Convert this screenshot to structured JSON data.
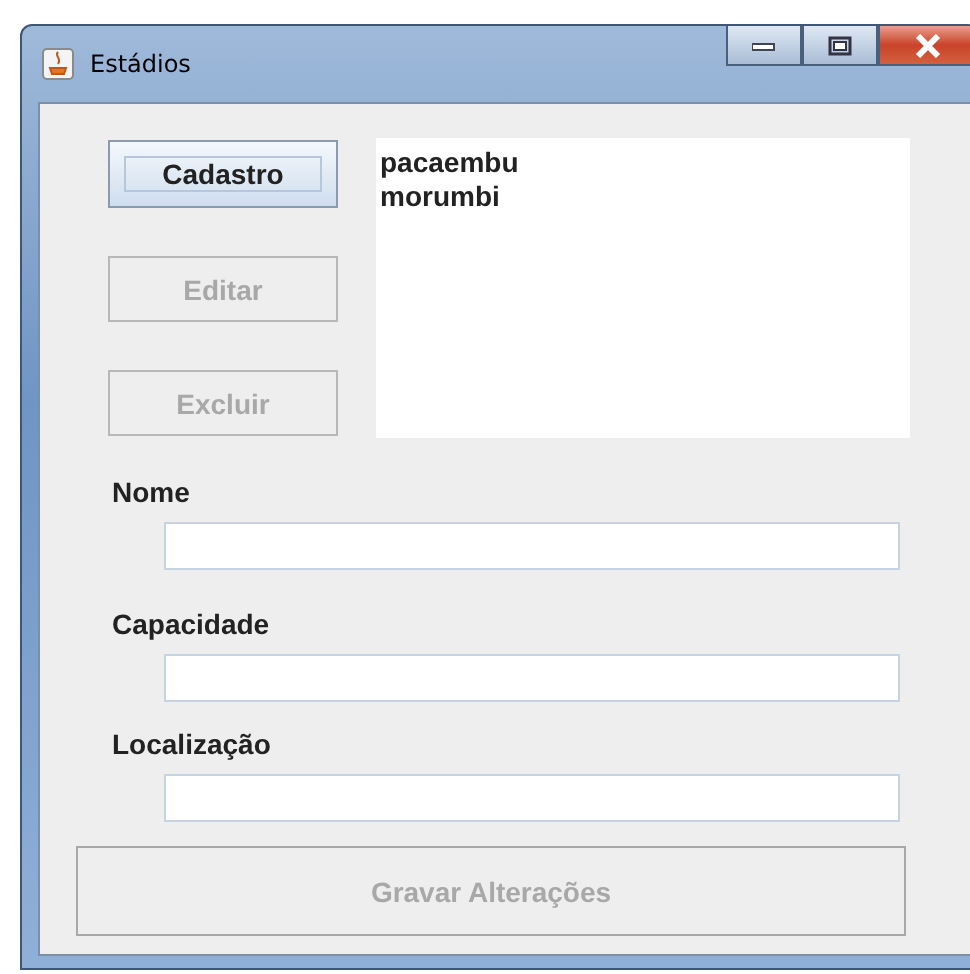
{
  "window": {
    "title": "Estádios"
  },
  "buttons": [
    {
      "label": "Cadastro",
      "disabled": false,
      "focused": true
    },
    {
      "label": "Editar",
      "disabled": true,
      "focused": false
    },
    {
      "label": "Excluir",
      "disabled": true,
      "focused": false
    }
  ],
  "list": {
    "items": [
      "pacaembu",
      "morumbi"
    ]
  },
  "fields": [
    {
      "label": "Nome"
    },
    {
      "label": "Capacidade"
    },
    {
      "label": "Localização"
    }
  ],
  "save_button": {
    "label": "Gravar Alterações",
    "disabled": true
  }
}
